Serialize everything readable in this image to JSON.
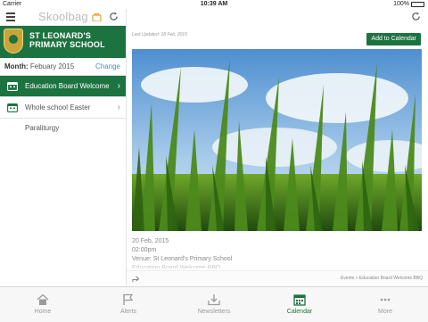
{
  "status": {
    "carrier": "Carrier",
    "time": "10:39 AM",
    "battery": "100%"
  },
  "sidebar": {
    "brand": "Skoolbag",
    "school_name_line1": "ST LEONARD'S",
    "school_name_line2": "PRIMARY SCHOOL",
    "month_label": "Month:",
    "month_value": "Febuary 2015",
    "change_label": "Change",
    "events": [
      {
        "title": "Education Board Welcome BBQ",
        "active": true
      },
      {
        "title": "Whole school Easter Paraliturgy",
        "active": false
      }
    ]
  },
  "main": {
    "last_updated": "Last Updated: 18 Feb, 2015",
    "add_button": "Add to Calendar",
    "date": "20 Feb, 2015",
    "time": "02:00pm",
    "venue": "Venue: St Leonard's Primary School",
    "faint_line": "Education Board Welcome BBQ",
    "breadcrumb": "Events > Education Board Welcome BBQ"
  },
  "tabs": [
    {
      "label": "Home",
      "icon": "home-icon",
      "active": false
    },
    {
      "label": "Alerts",
      "icon": "flag-icon",
      "active": false
    },
    {
      "label": "Newsletters",
      "icon": "download-tray-icon",
      "active": false
    },
    {
      "label": "Calendar",
      "icon": "calendar-icon",
      "active": true
    },
    {
      "label": "More",
      "icon": "more-dots-icon",
      "active": false
    }
  ],
  "colors": {
    "accent": "#1d7340",
    "link": "#4a90c8",
    "brand_highlight": "#e6a23c"
  }
}
